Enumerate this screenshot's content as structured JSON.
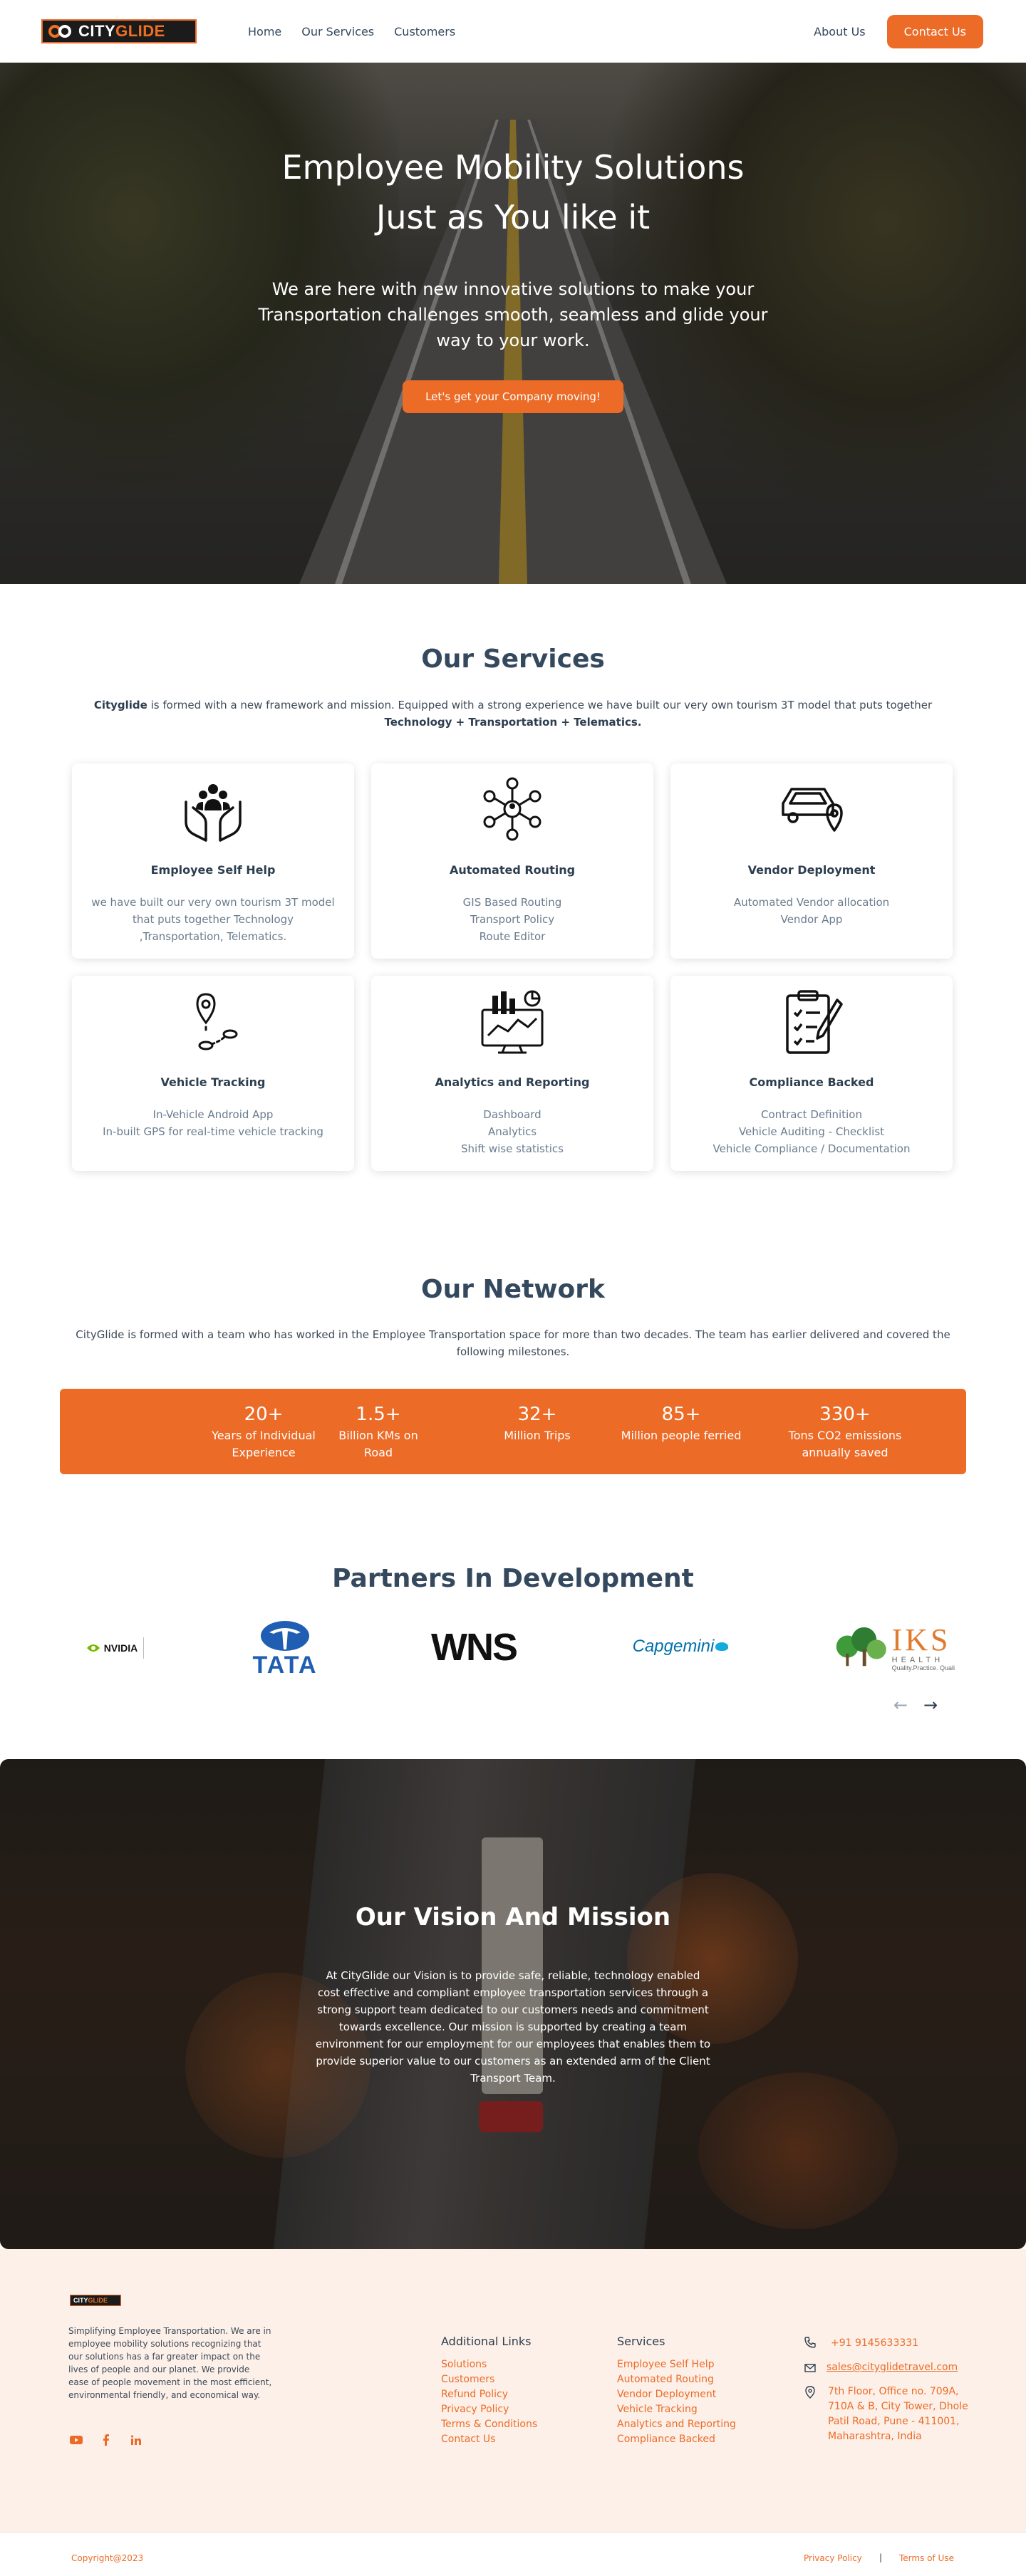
{
  "header": {
    "logo_text_a": "CITY",
    "logo_text_b": "GLIDE",
    "nav": [
      "Home",
      "Our Services",
      "Customers"
    ],
    "about": "About Us",
    "contact": "Contact Us"
  },
  "hero": {
    "title_line1": "Employee Mobility Solutions",
    "title_line2": "Just as You like it",
    "subtitle": "We are here with new innovative solutions to make your Transportation challenges smooth, seamless and glide your way to your work.",
    "cta": "Let's get your Company moving!"
  },
  "services": {
    "title": "Our Services",
    "desc_brand": "Cityglide",
    "desc_text": " is formed with a new framework and mission. Equipped with a strong experience we have built our very own tourism 3T model that puts together ",
    "desc_bold": "Technology + Transportation + Telematics.",
    "cards": [
      {
        "icon": "hands-people-icon",
        "title": "Employee Self Help",
        "lines": [
          "we have built our very own tourism 3T model",
          "that puts together Technology",
          ",Transportation, Telematics."
        ]
      },
      {
        "icon": "network-routing-icon",
        "title": "Automated Routing",
        "lines": [
          "GIS Based Routing",
          "Transport Policy",
          "Route Editor"
        ]
      },
      {
        "icon": "car-location-icon",
        "title": "Vendor Deployment",
        "lines": [
          "Automated Vendor allocation",
          "Vendor App"
        ]
      },
      {
        "icon": "map-pin-route-icon",
        "title": "Vehicle Tracking",
        "lines": [
          "In-Vehicle Android App",
          "In-built GPS for real-time vehicle tracking"
        ]
      },
      {
        "icon": "analytics-monitor-icon",
        "title": "Analytics and Reporting",
        "lines": [
          "Dashboard",
          "Analytics",
          "Shift wise statistics"
        ]
      },
      {
        "icon": "clipboard-checklist-icon",
        "title": "Compliance Backed",
        "lines": [
          "Contract Definition",
          "Vehicle Auditing - Checklist",
          "Vehicle Compliance / Documentation"
        ]
      }
    ]
  },
  "network": {
    "title": "Our Network",
    "desc": "CityGlide is formed with a team who has worked in the Employee Transportation space for more than two decades. The team has earlier delivered and covered the following milestones.",
    "stats": [
      {
        "value": "20+",
        "label_1": "Years of Individual",
        "label_2": "Experience"
      },
      {
        "value": "1.5+",
        "label_1": "Billion KMs on",
        "label_2": "Road"
      },
      {
        "value": "32+",
        "label_1": "Million Trips",
        "label_2": ""
      },
      {
        "value": "85+",
        "label_1": "Million people ferried",
        "label_2": ""
      },
      {
        "value": "330+",
        "label_1": "Tons CO2 emissions",
        "label_2": "annually saved"
      }
    ]
  },
  "partners": {
    "title": "Partners In Development",
    "logos": [
      "NVIDIA",
      "TATA",
      "WNS",
      "Capgemini",
      "IKS",
      "HEALTH",
      "Quality.Practice. Quali"
    ],
    "prev": "←",
    "next": "→"
  },
  "vision": {
    "title": "Our Vision And Mission",
    "text": "At CityGlide our Vision is to provide safe, reliable, technology enabled cost effective and compliant employee transportation services through a strong support team dedicated to our customers needs and commitment towards excellence. Our mission is supported by creating a team environment for our employment for our employees that enables them to provide superior value to our customers as an extended arm of the Client Transport Team."
  },
  "footer": {
    "logo_a": "CITY",
    "logo_b": "GLIDE",
    "about": "Simplifying Employee Transportation. We are in employee mobility solutions recognizing that our solutions has a far greater impact on the lives of people and our planet. We provide ease of people movement in the most efficient, environmental friendly, and economical way.",
    "social": [
      "youtube-icon",
      "facebook-icon",
      "linkedin-icon"
    ],
    "links_title": "Additional Links",
    "links": [
      "Solutions",
      "Customers",
      "Refund Policy",
      "Privacy Policy",
      "Terms & Conditions",
      "Contact Us"
    ],
    "services_title": "Services",
    "services": [
      "Employee Self Help",
      "Automated Routing",
      "Vendor Deployment",
      "Vehicle Tracking",
      "Analytics and Reporting",
      "Compliance Backed"
    ],
    "phone": "+91 9145633331",
    "email": "sales@cityglidetravel.com",
    "address_1": "7th Floor, Office no. 709A,",
    "address_2": "710A & B, City Tower, Dhole",
    "address_3": "Patil Road, Pune - 411001,",
    "address_4": "Maharashtra, India",
    "copyright": "Copyright@2023",
    "privacy": "Privacy Policy",
    "separator": "|",
    "terms": "Terms of Use"
  },
  "colors": {
    "accent": "#ec6b27",
    "heading": "#34495e",
    "footer_bg": "#fdf0e8"
  }
}
